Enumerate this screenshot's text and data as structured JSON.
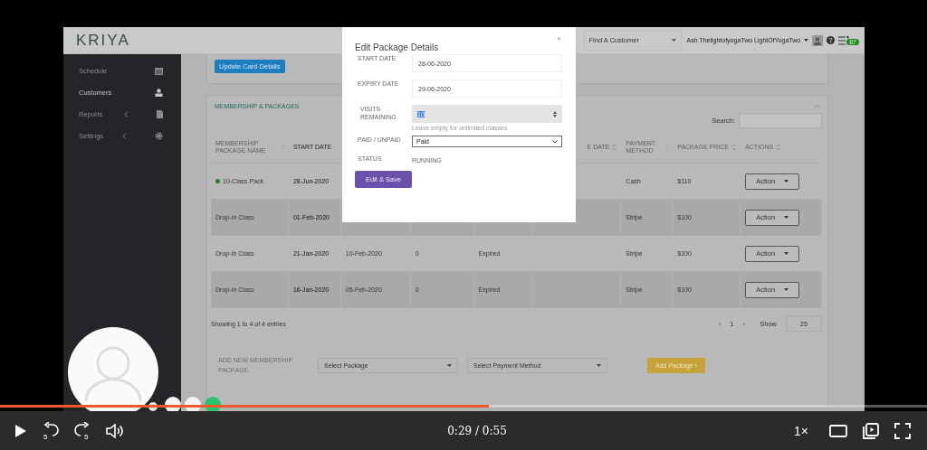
{
  "header": {
    "logo": "KRIYA",
    "customer_search": {
      "placeholder": "Find A Customer"
    },
    "user": "Ash ThelightofyogaTwo LightOfYogaTwo",
    "notification_count": "87"
  },
  "sidebar": {
    "items": [
      {
        "label": "Schedule",
        "expandable": false,
        "selected": false
      },
      {
        "label": "Customers",
        "expandable": false,
        "selected": true
      },
      {
        "label": "Reports",
        "expandable": true,
        "selected": false
      },
      {
        "label": "Settings",
        "expandable": true,
        "selected": false
      }
    ]
  },
  "update_card_button": "Update Card Details",
  "memberships": {
    "title": "MEMBERSHIP & PACKAGES",
    "search_label": "Search:",
    "table": {
      "columns": [
        {
          "label": "MEMBERSHIP PACKAGE NAME",
          "sortable": true
        },
        {
          "label": "START DATE",
          "sortable": false
        },
        null,
        null,
        null,
        {
          "label": "E DATE",
          "sortable": true
        },
        {
          "label": "PAYMENT METHOD",
          "sortable": true
        },
        {
          "label": "PACKAGE PRICE",
          "sortable": true
        },
        {
          "label": "ACTIONS",
          "sortable": true
        }
      ],
      "rows": [
        {
          "active": true,
          "cells": [
            "10-Class Pack",
            "28-Jun-2020",
            null,
            null,
            null,
            null,
            "Cash",
            "$110"
          ],
          "action": "Action"
        },
        {
          "active": false,
          "cells": [
            "Drop-In Class",
            "01-Feb-2020",
            null,
            null,
            null,
            null,
            "Stripe",
            "$100"
          ],
          "action": "Action"
        },
        {
          "active": false,
          "cells": [
            "Drop-In Class",
            "21-Jan-2020",
            "10-Feb-2020",
            "0",
            "Expired",
            null,
            "Stripe",
            "$100"
          ],
          "action": "Action"
        },
        {
          "active": false,
          "cells": [
            "Drop-In Class",
            "16-Jan-2020",
            "05-Feb-2020",
            "0",
            "Expired",
            null,
            "Stripe",
            "$100"
          ],
          "action": "Action"
        }
      ]
    },
    "info": "Showing 1 to 4 of 4 entries",
    "pagination": {
      "prev": "‹",
      "page": "1",
      "next": "›"
    },
    "show_label": "Show",
    "page_size": "25",
    "add": {
      "label": "ADD NEW MEMBERSHIP PACKAGE",
      "package_select": "Select Package",
      "payment_select": "Select Payment Method",
      "button": "Add Package ›"
    }
  },
  "modal": {
    "title": "Edit Package Details",
    "close": "×",
    "fields": [
      {
        "kind": "input",
        "label": "START DATE",
        "value": "28-06-2020"
      },
      {
        "kind": "input",
        "label": "EXPIRY DATE",
        "value": "29-06-2020"
      },
      {
        "kind": "number",
        "label": "VISITS REMAINING",
        "value": "10",
        "hint": "Leave empty for unlimited classes"
      },
      {
        "kind": "select",
        "label": "PAID / UNPAID",
        "value": "Paid"
      },
      {
        "kind": "text",
        "label": "STATUS",
        "value": "RUNNING"
      }
    ],
    "button": "Edit & Save"
  },
  "player": {
    "progress": {
      "level": 0.527
    },
    "rewind": "5",
    "forward": "5",
    "time": "0:29 / 0:55",
    "speed": "1×"
  }
}
